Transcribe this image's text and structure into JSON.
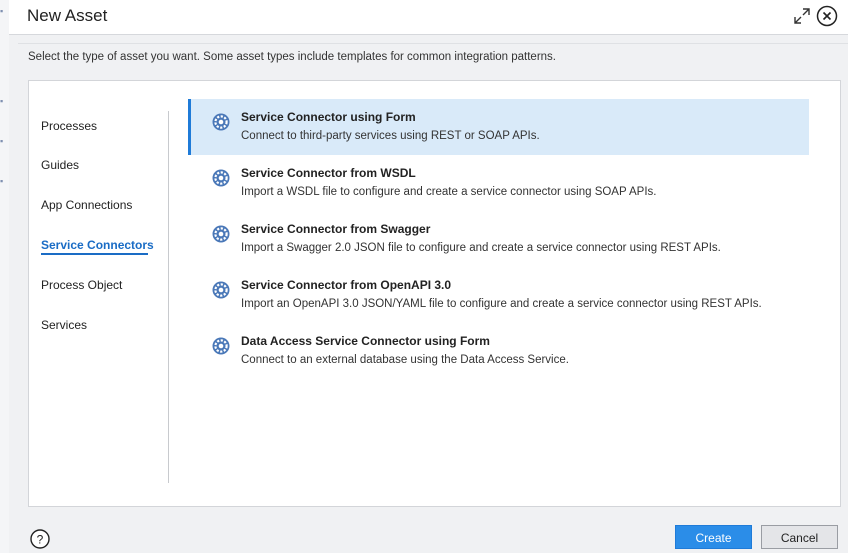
{
  "dialog": {
    "title": "New Asset",
    "instructions": "Select the type of asset you want. Some asset types include templates for common integration patterns."
  },
  "sidebar": {
    "items": [
      {
        "label": "Processes",
        "active": false
      },
      {
        "label": "Guides",
        "active": false
      },
      {
        "label": "App Connections",
        "active": false
      },
      {
        "label": "Service Connectors",
        "active": true
      },
      {
        "label": "Process Object",
        "active": false
      },
      {
        "label": "Services",
        "active": false
      }
    ]
  },
  "options": [
    {
      "title": "Service Connector using Form",
      "description": "Connect to third-party services using REST or SOAP APIs.",
      "selected": true,
      "icon": "gear-icon"
    },
    {
      "title": "Service Connector from WSDL",
      "description": "Import a WSDL file to configure and create a service connector using SOAP APIs.",
      "selected": false,
      "icon": "gear-icon"
    },
    {
      "title": "Service Connector from Swagger",
      "description": "Import a Swagger 2.0 JSON file to configure and create a service connector using REST APIs.",
      "selected": false,
      "icon": "gear-icon"
    },
    {
      "title": "Service Connector from OpenAPI 3.0",
      "description": "Import an OpenAPI 3.0 JSON/YAML file to configure and create a service connector using REST APIs.",
      "selected": false,
      "icon": "gear-icon"
    },
    {
      "title": "Data Access Service Connector using Form",
      "description": "Connect to an external database using the Data Access Service.",
      "selected": false,
      "icon": "gear-icon"
    }
  ],
  "footer": {
    "help_symbol": "?",
    "create_label": "Create",
    "cancel_label": "Cancel"
  },
  "colors": {
    "accent": "#1a6cc5",
    "selected_bg": "#d9eaf9",
    "primary_button": "#2b8de8"
  }
}
